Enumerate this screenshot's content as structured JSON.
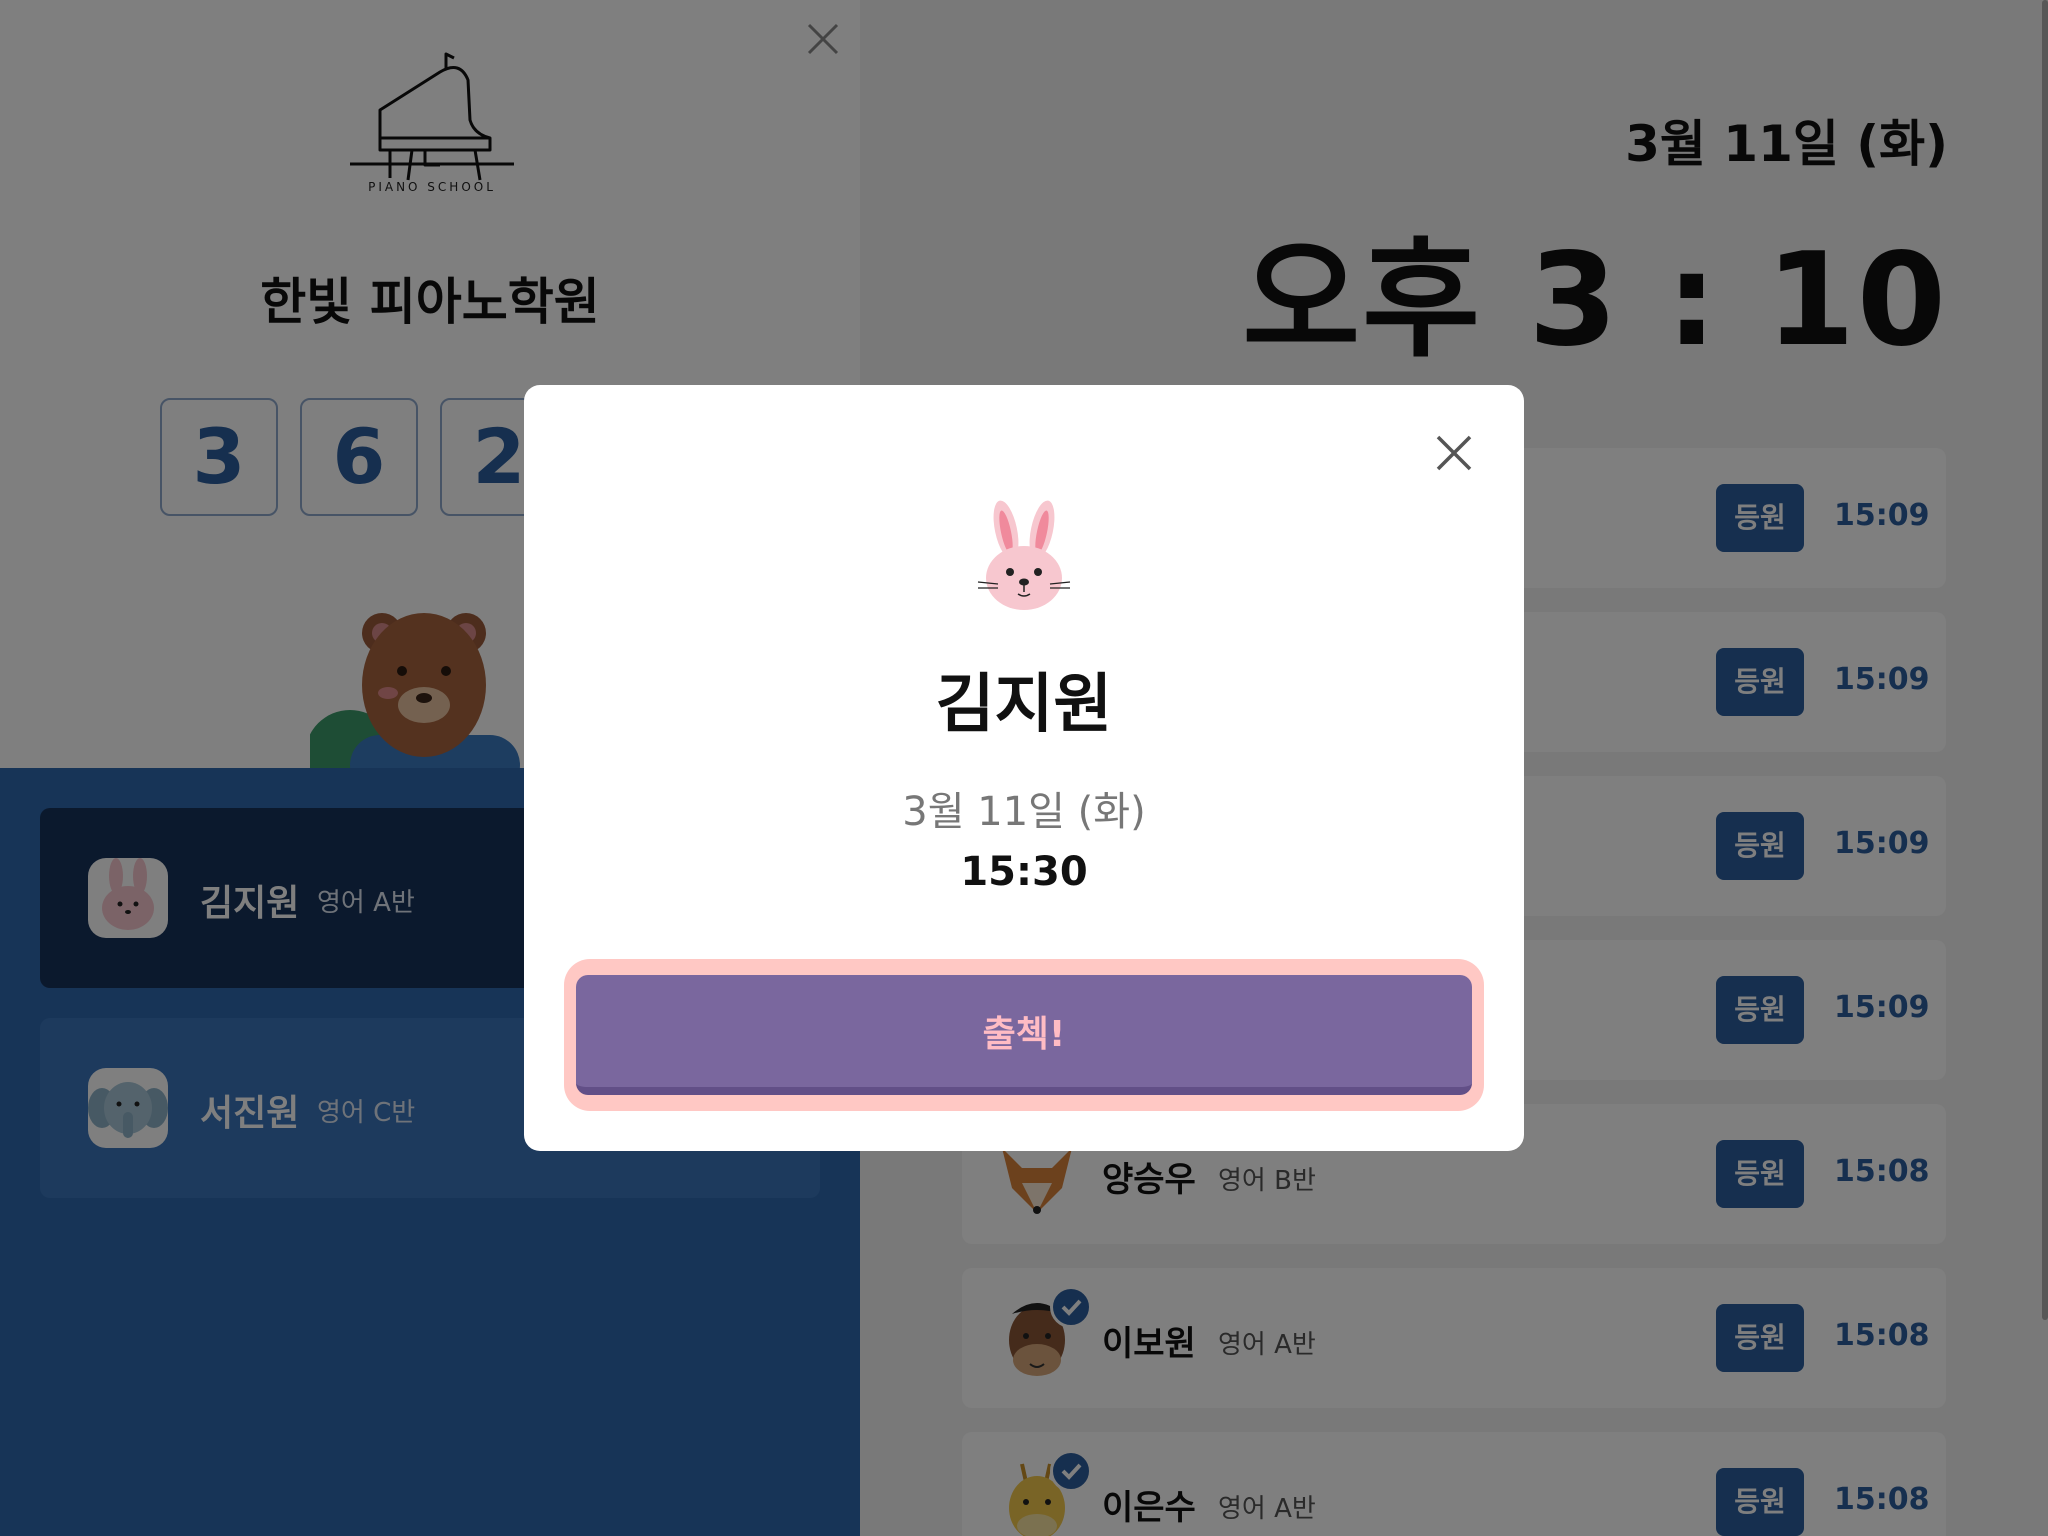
{
  "school": {
    "logo_caption": "PIANO SCHOOL",
    "name": "한빛 피아노학원"
  },
  "code_digits": [
    "3",
    "6",
    "2"
  ],
  "left_students": [
    {
      "name": "김지원",
      "class": "영어 A반",
      "avatar": "rabbit-icon",
      "active": true
    },
    {
      "name": "서진원",
      "class": "영어 C반",
      "avatar": "elephant-icon",
      "active": false
    }
  ],
  "header": {
    "date": "3월 11일 (화)",
    "clock": "오후 3 : 10"
  },
  "attendance": [
    {
      "name": "",
      "class": "",
      "status": "등원",
      "time": "15:09"
    },
    {
      "name": "",
      "class": "",
      "status": "등원",
      "time": "15:09"
    },
    {
      "name": "",
      "class": "",
      "status": "등원",
      "time": "15:09"
    },
    {
      "name": "",
      "class": "",
      "status": "등원",
      "time": "15:09"
    },
    {
      "name": "양승우",
      "class": "영어 B반",
      "status": "등원",
      "time": "15:08",
      "avatar": "fox-icon"
    },
    {
      "name": "이보원",
      "class": "영어 A반",
      "status": "등원",
      "time": "15:08",
      "avatar": "horse-icon"
    },
    {
      "name": "이은수",
      "class": "영어 A반",
      "status": "등원",
      "time": "15:08",
      "avatar": "giraffe-icon"
    }
  ],
  "modal": {
    "name": "김지원",
    "date": "3월 11일 (화)",
    "time": "15:30",
    "button_label": "출첵!",
    "avatar": "rabbit-icon"
  },
  "colors": {
    "primary_blue": "#2c5e9e",
    "modal_button": "#7a679e",
    "modal_button_ring": "#ffc8c4",
    "button_text": "#ffbcc4"
  }
}
